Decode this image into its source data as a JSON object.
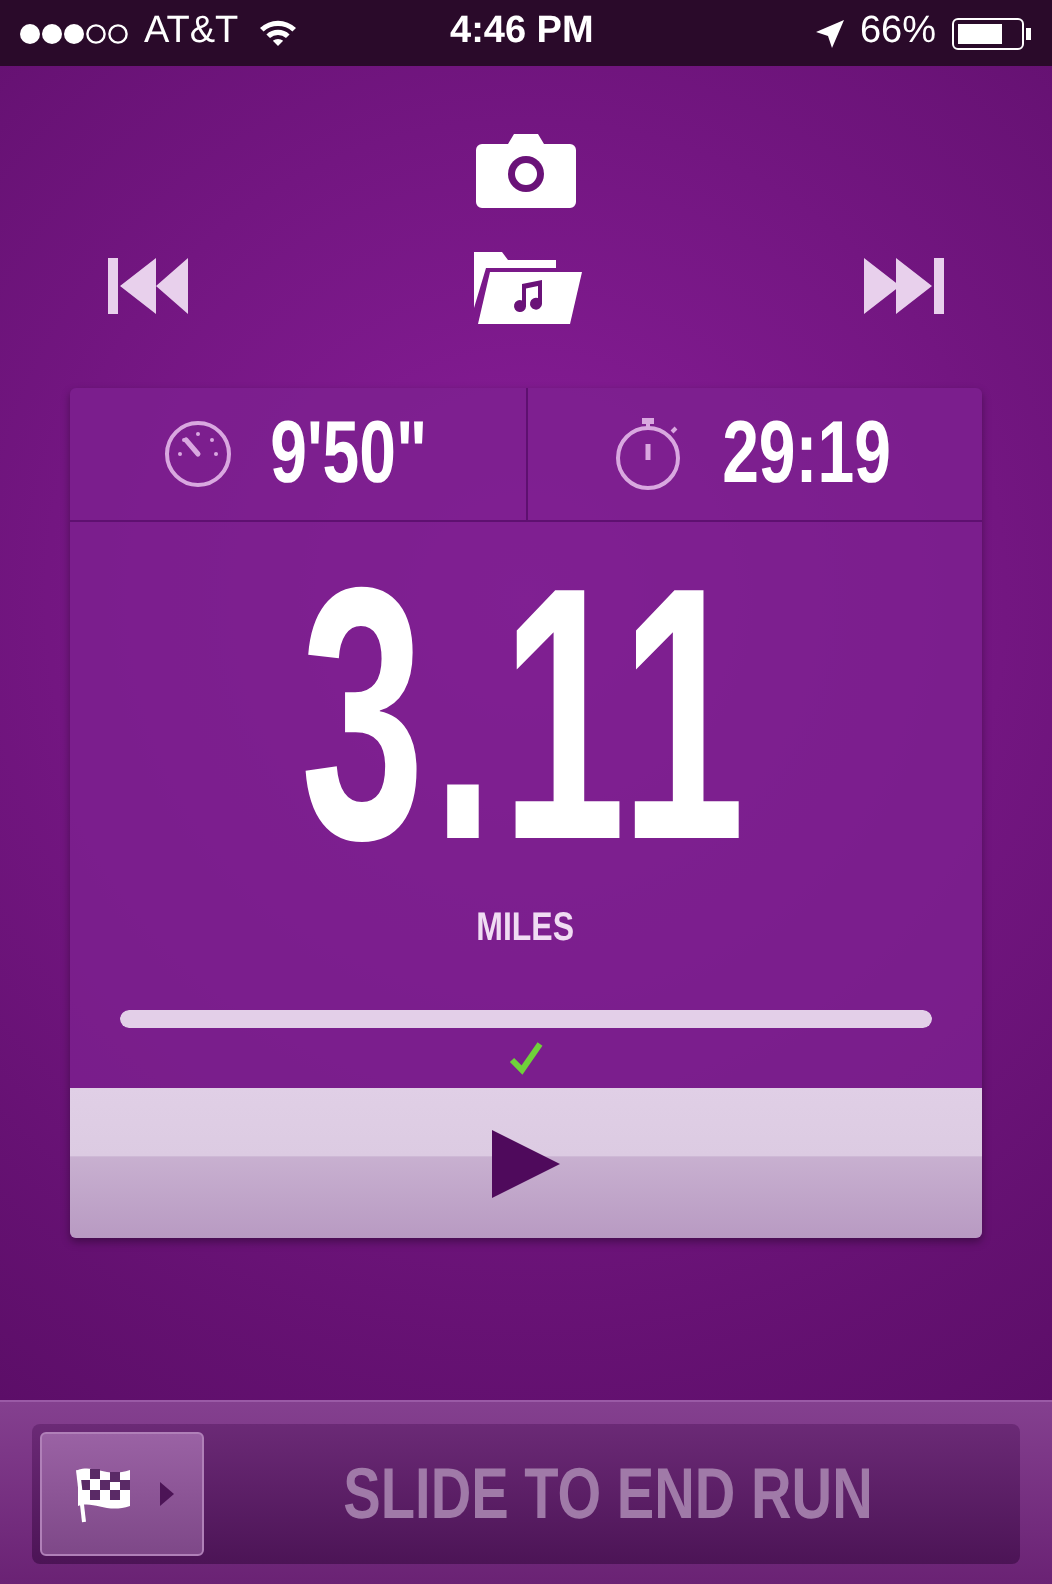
{
  "status_bar": {
    "carrier": "AT&T",
    "time": "4:46 PM",
    "battery": "66%"
  },
  "run": {
    "pace": "9'50\"",
    "duration": "29:19",
    "distance": "3.11",
    "unit": "MILES",
    "progress": {
      "level": 1,
      "goal_reached": true
    }
  },
  "end_slider": {
    "label": "SLIDE TO END RUN"
  }
}
